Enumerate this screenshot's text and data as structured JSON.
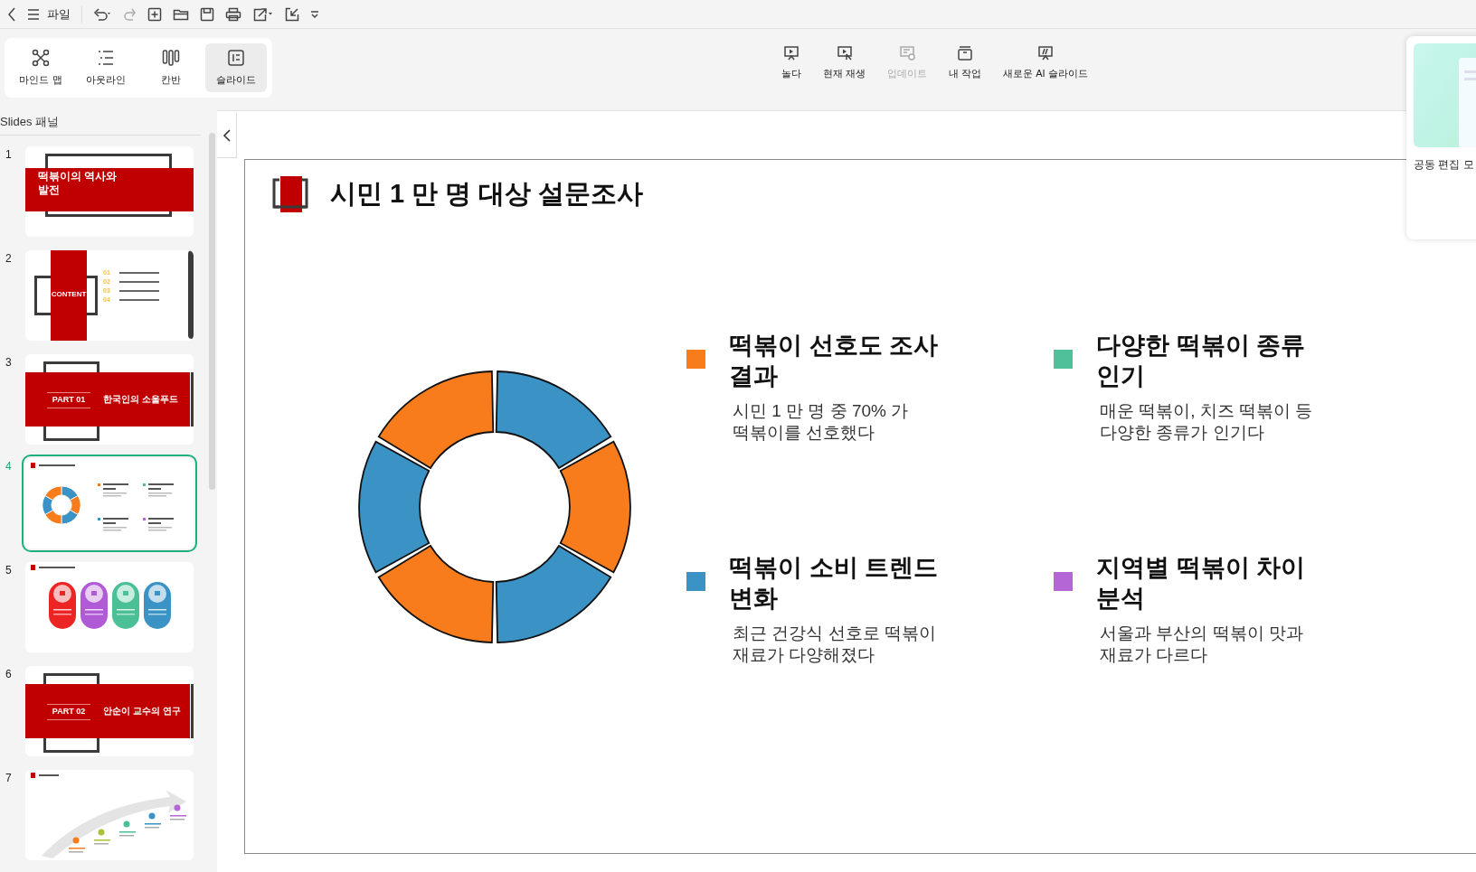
{
  "top_bar": {
    "menu_label": "파일"
  },
  "view_tabs": [
    {
      "label": "마인드 맵",
      "selected": false
    },
    {
      "label": "아웃라인",
      "selected": false
    },
    {
      "label": "칸반",
      "selected": false
    },
    {
      "label": "슬라이드",
      "selected": true
    }
  ],
  "actions": [
    {
      "label": "놀다",
      "disabled": false
    },
    {
      "label": "현재 재생",
      "disabled": false
    },
    {
      "label": "업데이트",
      "disabled": true
    },
    {
      "label": "내 작업",
      "disabled": false
    },
    {
      "label": "새로운 AI 슬라이드",
      "disabled": false
    }
  ],
  "side_card": {
    "label": "공동 편집 모"
  },
  "slides_panel": {
    "title": "Slides 패널",
    "slides": [
      {
        "number": "1",
        "kind": "cover",
        "selected": false,
        "title": "떡볶이의 역사와 발전"
      },
      {
        "number": "2",
        "kind": "contents",
        "selected": false,
        "title": "CONTENT",
        "items": [
          "01",
          "02",
          "03",
          "04"
        ]
      },
      {
        "number": "3",
        "kind": "section",
        "selected": false,
        "part": "PART 01",
        "title": "한국인의 소울푸드"
      },
      {
        "number": "4",
        "kind": "chart",
        "selected": true
      },
      {
        "number": "5",
        "kind": "cards",
        "selected": false
      },
      {
        "number": "6",
        "kind": "section",
        "selected": false,
        "part": "PART 02",
        "title": "안순이 교수의 연구"
      },
      {
        "number": "7",
        "kind": "timeline",
        "selected": false
      }
    ]
  },
  "slide": {
    "title": "시민 1 만 명 대상 설문조사",
    "items": [
      {
        "title": "떡볶이 선호도 조사 결과",
        "body": "시민 1 만 명 중 70% 가 떡볶이를 선호했다",
        "color": "#f97c1c"
      },
      {
        "title": "다양한 떡볶이 종류 인기",
        "body": "매운 떡볶이, 치즈 떡볶이 등 다양한 종류가 인기다",
        "color": "#4fc09a"
      },
      {
        "title": "떡볶이 소비 트렌드 변화",
        "body": "최근 건강식 선호로 떡볶이 재료가 다양해졌다",
        "color": "#3b92c4"
      },
      {
        "title": "지역별 떡볶이 차이 분석",
        "body": "서울과 부산의 떡볶이 맛과 재료가 다르다",
        "color": "#b566d6"
      }
    ]
  }
}
